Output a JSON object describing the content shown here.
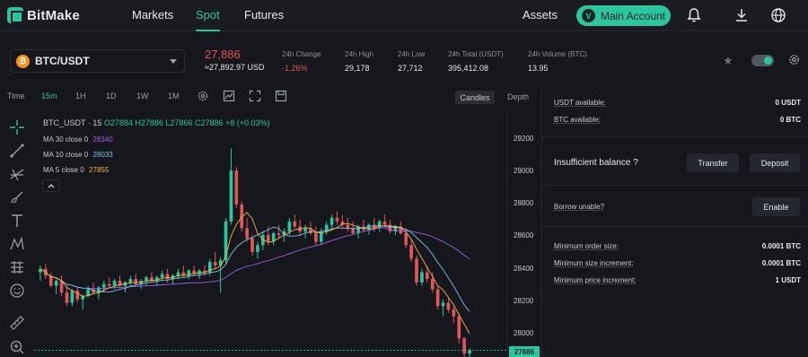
{
  "brand": {
    "name": "BitMake"
  },
  "nav": {
    "links": [
      {
        "label": "Markets"
      },
      {
        "label": "Spot"
      },
      {
        "label": "Futures"
      }
    ],
    "assets": "Assets",
    "account_badge": "V",
    "main_account": "Main Account",
    "icons": [
      "bell-icon",
      "download-icon",
      "globe-icon"
    ]
  },
  "ticker": {
    "pair": "BTC/USDT",
    "coin_glyph": "₿",
    "last_price": "27,886",
    "last_price_fiat": "≈27,892.97 USD",
    "stats": [
      {
        "label": "24h Change",
        "value": "-1.26%"
      },
      {
        "label": "24h High",
        "value": "29,178"
      },
      {
        "label": "24h Low",
        "value": "27,712"
      },
      {
        "label": "24h Total (USDT)",
        "value": "395,412.08"
      },
      {
        "label": "24h Volume (BTC)",
        "value": "13.95"
      }
    ]
  },
  "toolbar": {
    "time_label": "Time",
    "intervals": [
      "15m",
      "1H",
      "1D",
      "1W",
      "1M"
    ],
    "active_interval": "15m",
    "view_candles": "Candles",
    "view_depth": "Depth"
  },
  "chart_legend": {
    "symbol": "BTC_USDT · 15",
    "ohlc": "O27884 H27886 L27866 C27886 +8 (+0.03%)",
    "ma": [
      {
        "label": "MA 30 close 0",
        "value": "28340",
        "color": "#a15ce6"
      },
      {
        "label": "MA 10 close 0",
        "value": "28033",
        "color": "#79c3e8"
      },
      {
        "label": "MA 5 close 0",
        "value": "27855",
        "color": "#f0b64a"
      }
    ]
  },
  "chart_data": {
    "type": "candlestick",
    "y_ticks": [
      "29200",
      "29000",
      "28800",
      "28600",
      "28400",
      "28200",
      "28000"
    ],
    "ylim": [
      27880,
      29330
    ],
    "last_price_tag": "27886",
    "up_color": "#2ec4a0",
    "down_color": "#e0565b",
    "candles": [
      [
        28380,
        28420,
        28330,
        28400
      ],
      [
        28400,
        28430,
        28340,
        28360
      ],
      [
        28360,
        28380,
        28290,
        28300
      ],
      [
        28300,
        28340,
        28250,
        28330
      ],
      [
        28330,
        28360,
        28240,
        28260
      ],
      [
        28260,
        28300,
        28180,
        28200
      ],
      [
        28200,
        28280,
        28180,
        28270
      ],
      [
        28270,
        28290,
        28200,
        28220
      ],
      [
        28220,
        28250,
        28160,
        28240
      ],
      [
        28240,
        28300,
        28230,
        28280
      ],
      [
        28280,
        28320,
        28250,
        28260
      ],
      [
        28260,
        28300,
        28220,
        28290
      ],
      [
        28290,
        28330,
        28260,
        28310
      ],
      [
        28310,
        28350,
        28290,
        28300
      ],
      [
        28300,
        28340,
        28280,
        28330
      ],
      [
        28330,
        28360,
        28290,
        28300
      ],
      [
        28300,
        28330,
        28260,
        28320
      ],
      [
        28320,
        28360,
        28300,
        28340
      ],
      [
        28340,
        28370,
        28300,
        28310
      ],
      [
        28310,
        28340,
        28280,
        28330
      ],
      [
        28330,
        28360,
        28300,
        28350
      ],
      [
        28350,
        28380,
        28320,
        28330
      ],
      [
        28330,
        28360,
        28300,
        28350
      ],
      [
        28350,
        28390,
        28330,
        28370
      ],
      [
        28370,
        28400,
        28320,
        28340
      ],
      [
        28340,
        28370,
        28310,
        28360
      ],
      [
        28360,
        28400,
        28340,
        28380
      ],
      [
        28380,
        28420,
        28350,
        28360
      ],
      [
        28360,
        28400,
        28340,
        28390
      ],
      [
        28390,
        28420,
        28360,
        28370
      ],
      [
        28370,
        28400,
        28340,
        28390
      ],
      [
        28390,
        28420,
        28360,
        28380
      ],
      [
        28380,
        28460,
        28360,
        28440
      ],
      [
        28440,
        28500,
        28400,
        28420
      ],
      [
        28420,
        28470,
        28260,
        28450
      ],
      [
        28450,
        28700,
        28430,
        28680
      ],
      [
        28680,
        29110,
        28660,
        28980
      ],
      [
        28980,
        29000,
        28760,
        28780
      ],
      [
        28780,
        28800,
        28620,
        28640
      ],
      [
        28640,
        28700,
        28560,
        28580
      ],
      [
        28580,
        28600,
        28480,
        28500
      ],
      [
        28500,
        28560,
        28460,
        28540
      ],
      [
        28540,
        28620,
        28510,
        28600
      ],
      [
        28600,
        28650,
        28540,
        28560
      ],
      [
        28560,
        28620,
        28540,
        28610
      ],
      [
        28610,
        28660,
        28580,
        28600
      ],
      [
        28600,
        28640,
        28560,
        28620
      ],
      [
        28620,
        28700,
        28600,
        28680
      ],
      [
        28680,
        28720,
        28640,
        28650
      ],
      [
        28650,
        28690,
        28600,
        28620
      ],
      [
        28620,
        28660,
        28580,
        28640
      ],
      [
        28640,
        28680,
        28600,
        28610
      ],
      [
        28610,
        28650,
        28540,
        28560
      ],
      [
        28560,
        28640,
        28540,
        28620
      ],
      [
        28620,
        28680,
        28600,
        28660
      ],
      [
        28660,
        28720,
        28640,
        28700
      ],
      [
        28700,
        28740,
        28660,
        28680
      ],
      [
        28680,
        28720,
        28640,
        28660
      ],
      [
        28660,
        28700,
        28620,
        28640
      ],
      [
        28640,
        28680,
        28600,
        28610
      ],
      [
        28610,
        28660,
        28580,
        28650
      ],
      [
        28650,
        28690,
        28620,
        28630
      ],
      [
        28630,
        28670,
        28600,
        28660
      ],
      [
        28660,
        28700,
        28620,
        28640
      ],
      [
        28640,
        28690,
        28620,
        28680
      ],
      [
        28680,
        28720,
        28650,
        28660
      ],
      [
        28660,
        28690,
        28610,
        28620
      ],
      [
        28620,
        28660,
        28600,
        28650
      ],
      [
        28650,
        28680,
        28600,
        28610
      ],
      [
        28610,
        28640,
        28520,
        28540
      ],
      [
        28540,
        28580,
        28440,
        28460
      ],
      [
        28460,
        28480,
        28300,
        28320
      ],
      [
        28320,
        28400,
        28300,
        28380
      ],
      [
        28380,
        28420,
        28320,
        28340
      ],
      [
        28340,
        28380,
        28260,
        28280
      ],
      [
        28280,
        28300,
        28160,
        28180
      ],
      [
        28180,
        28220,
        28120,
        28200
      ],
      [
        28200,
        28230,
        28140,
        28160
      ],
      [
        28160,
        28180,
        28080,
        28120
      ],
      [
        28120,
        28140,
        27960,
        27990
      ],
      [
        27990,
        28000,
        27880,
        27900
      ],
      [
        27900,
        27930,
        27880,
        27920
      ]
    ]
  },
  "right_panel": {
    "usdt_available_label": "USDT available:",
    "usdt_available_value": "0 USDT",
    "btc_available_label": "BTC available:",
    "btc_available_value": "0 BTC",
    "insufficient": "Insufficient balance ?",
    "transfer": "Transfer",
    "deposit": "Deposit",
    "borrow_label": "Borrow unable?",
    "enable": "Enable",
    "min_order_label": "Minimum order size:",
    "min_order_value": "0.0001 BTC",
    "min_size_inc_label": "Minimum size increment:",
    "min_size_inc_value": "0.0001 BTC",
    "min_price_inc_label": "Minimum price increment:",
    "min_price_inc_value": "1 USDT"
  }
}
